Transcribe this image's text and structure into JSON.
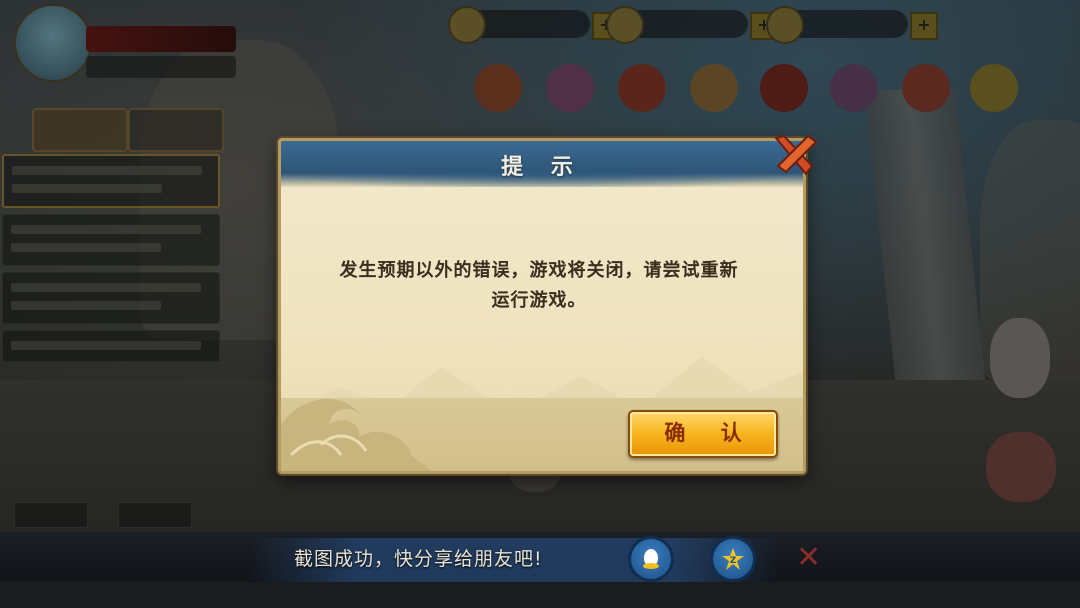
{
  "dialog": {
    "title": "提 示",
    "message_line1": "发生预期以外的错误，游戏将关闭，请尝试重新",
    "message_line2": "运行游戏。",
    "confirm_label": "确 认"
  },
  "share_bar": {
    "text": "截图成功，快分享给朋友吧!",
    "icons": [
      "qq-icon",
      "qzone-icon"
    ]
  },
  "colors": {
    "dialog_header": "#2e5577",
    "dialog_body": "#efe4c0",
    "confirm_button": "#f7b51d",
    "close_x": "#d04a24"
  }
}
